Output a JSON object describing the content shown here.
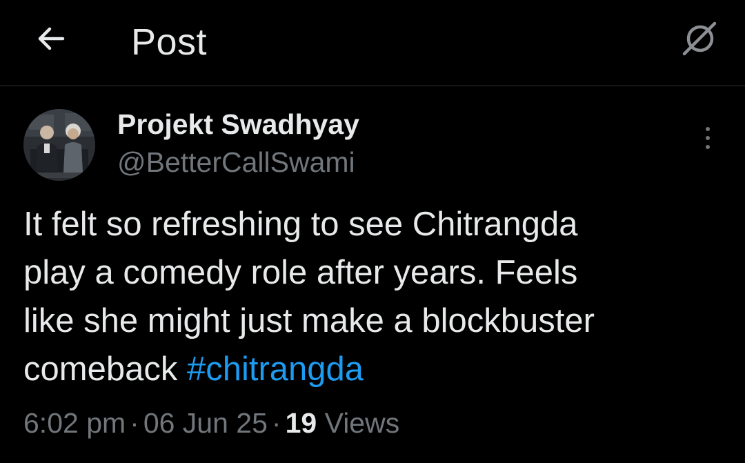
{
  "header": {
    "title": "Post",
    "back_icon": "arrow-left-icon",
    "grok_icon": "grok-icon"
  },
  "post": {
    "author_name": "Projekt Swadhyay",
    "author_handle": "@BetterCallSwami",
    "more_icon": "more-vertical-icon",
    "text_body": "It felt so refreshing to see Chitrangda\nplay a comedy role after years. Feels\nlike she might just make a blockbuster\ncomeback  ",
    "hashtag": "#chitrangda",
    "time": "6:02 pm",
    "date": "06 Jun 25",
    "views_count": "19",
    "views_label": "Views",
    "separator": "·"
  },
  "colors": {
    "background": "#000000",
    "text_primary": "#e7e9ea",
    "text_secondary": "#71767b",
    "hashtag": "#1d9bf0",
    "divider": "#2f3336"
  }
}
